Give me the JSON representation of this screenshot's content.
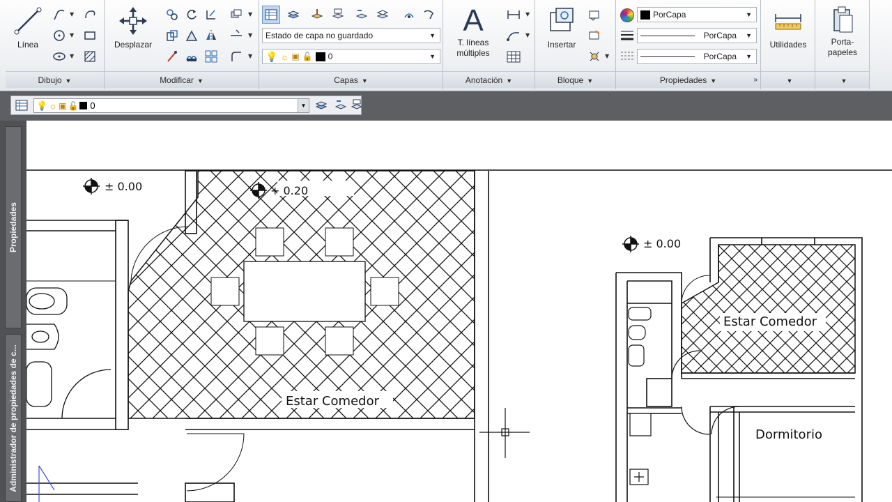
{
  "ribbon": {
    "dibujo": {
      "title": "Dibujo",
      "line_label": "Línea"
    },
    "modificar": {
      "title": "Modificar",
      "move_label": "Desplazar"
    },
    "capas": {
      "title": "Capas",
      "state_combo": "Estado de capa no guardado",
      "layer_value": "0"
    },
    "anotacion": {
      "title": "Anotación",
      "mtext_label_1": "T. líneas",
      "mtext_label_2": "múltiples"
    },
    "bloque": {
      "title": "Bloque",
      "insert_label": "Insertar"
    },
    "propiedades": {
      "title": "Propiedades",
      "color_value": "PorCapa",
      "lineweight_value": "PorCapa",
      "linetype_value": "PorCapa"
    },
    "utilidades": {
      "label": "Utilidades"
    },
    "portapapeles": {
      "label_1": "Porta-",
      "label_2": "papeles"
    }
  },
  "layer_toolbar": {
    "current_layer": "0"
  },
  "palettes": {
    "propiedades_tab": "Propiedades",
    "admin_tab": "Administrador de propiedades de c..."
  },
  "drawing": {
    "level_labels": [
      "± 0.00",
      "+ 0.20",
      "± 0.00"
    ],
    "room_labels": [
      "Estar Comedor",
      "Estar Comedor",
      "Dormitorio"
    ]
  },
  "colors": {
    "accent": "#bcd6f4",
    "ribbon_bg": "#eef0f3",
    "toolbar_bg": "#5d5f62"
  }
}
